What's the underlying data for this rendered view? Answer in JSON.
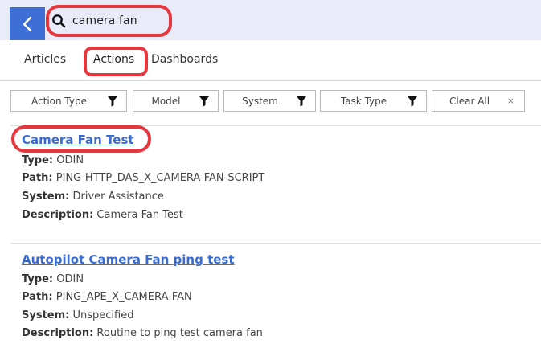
{
  "search": {
    "query": "camera fan",
    "back_icon": "chevron-left-icon",
    "search_icon": "search-icon"
  },
  "tabs": [
    {
      "label": "Articles"
    },
    {
      "label": "Actions",
      "active": true
    },
    {
      "label": "Dashboards"
    }
  ],
  "filters": {
    "items": [
      {
        "label": "Action Type",
        "icon": "funnel-icon"
      },
      {
        "label": "Model",
        "icon": "funnel-icon"
      },
      {
        "label": "System",
        "icon": "funnel-icon"
      },
      {
        "label": "Task Type",
        "icon": "funnel-icon"
      }
    ],
    "clear_label": "Clear All",
    "clear_icon": "×"
  },
  "results": [
    {
      "title": "Camera Fan Test",
      "type_label": "Type:",
      "type_value": "ODIN",
      "path_label": "Path:",
      "path_value": "PING-HTTP_DAS_X_CAMERA-FAN-SCRIPT",
      "system_label": "System:",
      "system_value": "Driver Assistance",
      "description_label": "Description:",
      "description_value": "Camera Fan Test"
    },
    {
      "title": "Autopilot Camera Fan ping test",
      "type_label": "Type:",
      "type_value": "ODIN",
      "path_label": "Path:",
      "path_value": "PING_APE_X_CAMERA-FAN",
      "system_label": "System:",
      "system_value": "Unspecified",
      "description_label": "Description:",
      "description_value": "Routine to ping test camera fan"
    }
  ],
  "colors": {
    "accent": "#3e6fd6",
    "link": "#3a6bd0",
    "highlight": "#e8363f",
    "topbar": "#e9ebf8"
  }
}
